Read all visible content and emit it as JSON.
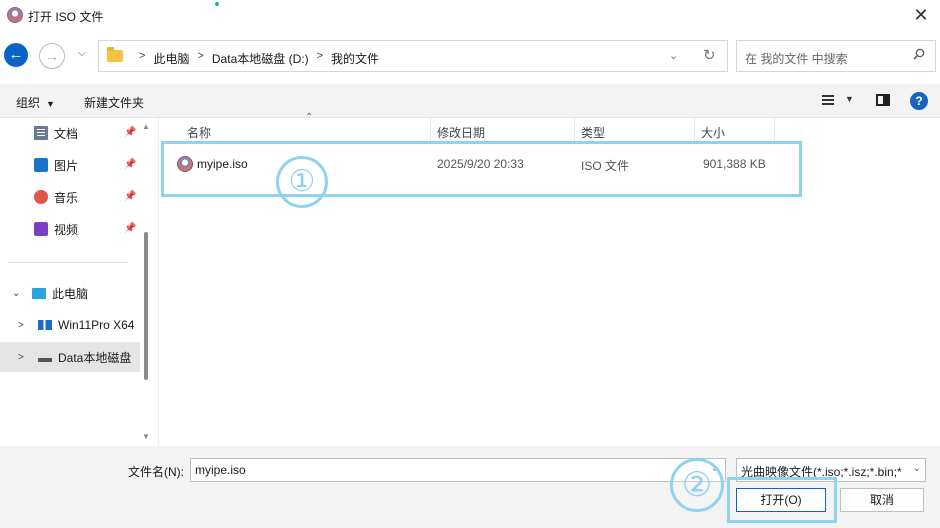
{
  "window": {
    "title": "打开 ISO 文件",
    "close": "✕"
  },
  "nav": {
    "back": "←",
    "forward": "→",
    "breadcrumbs": [
      "此电脑",
      "Data本地磁盘 (D:)",
      "我的文件"
    ],
    "search_placeholder": "在 我的文件 中搜索"
  },
  "toolbar": {
    "organize": "组织",
    "new_folder": "新建文件夹",
    "help": "?"
  },
  "sidebar": {
    "items": [
      {
        "label": "文档",
        "icon": "documents-icon",
        "pinned": true
      },
      {
        "label": "图片",
        "icon": "pictures-icon",
        "pinned": true
      },
      {
        "label": "音乐",
        "icon": "music-icon",
        "pinned": true
      },
      {
        "label": "视频",
        "icon": "videos-icon",
        "pinned": true
      },
      {
        "label": "此电脑",
        "icon": "this-pc-icon",
        "expanded": true
      },
      {
        "label": "Win11Pro X64",
        "icon": "network-drive-icon"
      },
      {
        "label": "Data本地磁盘",
        "icon": "drive-icon",
        "selected": true
      }
    ]
  },
  "list": {
    "columns": [
      "名称",
      "修改日期",
      "类型",
      "大小"
    ],
    "rows": [
      {
        "name": "myipe.iso",
        "modified": "2025/9/20 20:33",
        "type": "ISO 文件",
        "size": "901,388 KB"
      }
    ]
  },
  "footer": {
    "filename_label": "文件名(N):",
    "filename_value": "myipe.iso",
    "filter": "光曲映像文件(*.iso;*.isz;*.bin;*",
    "open": "打开(O)",
    "cancel": "取消"
  },
  "annotations": {
    "step1": "①",
    "step2": "②"
  },
  "colors": {
    "accent": "#0a64c8",
    "highlight": "#8fd3f0"
  }
}
